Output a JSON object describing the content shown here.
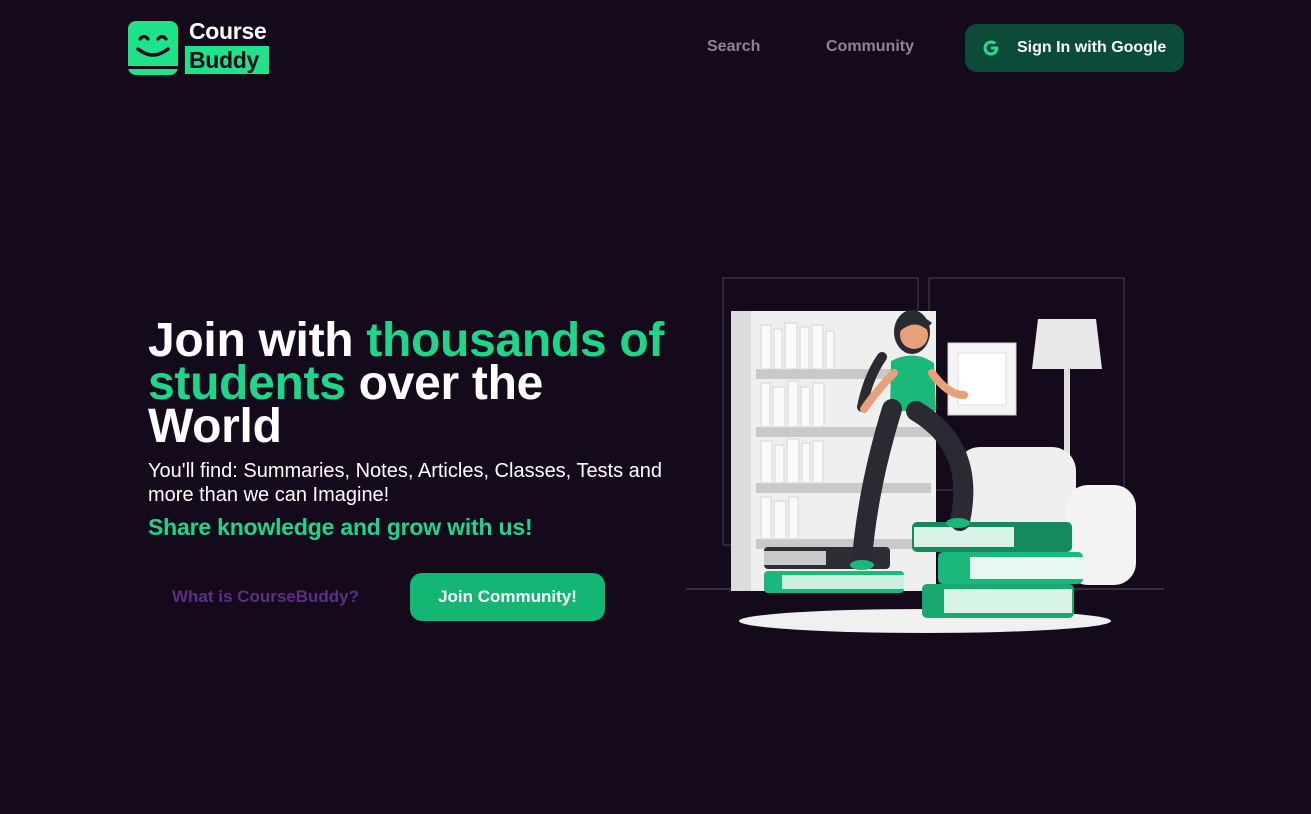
{
  "header": {
    "logo": {
      "line1": "Course",
      "line2": "Buddy"
    },
    "nav": {
      "search": "Search",
      "community": "Community"
    },
    "signin": {
      "label": "Sign In with Google",
      "icon": "google-icon"
    }
  },
  "hero": {
    "title": {
      "part1": "Join with ",
      "accent": "thousands of students",
      "part2": " over the World"
    },
    "subtitle": "You'll find: Summaries, Notes, Articles, Classes, Tests and more than we can Imagine!",
    "tagline": "Share knowledge and grow with us!",
    "buttons": {
      "what": "What is CourseBuddy?",
      "join": "Join Community!"
    }
  },
  "colors": {
    "background": "#140a1c",
    "accent": "#1dd68a",
    "logo_green": "#1fe38b",
    "google_button": "#0c4a3a",
    "join_button": "#13b672",
    "nav_text": "#8b8597",
    "secondary_link": "#5d2e85"
  },
  "illustration": {
    "icon": "student-climbing-books-illustration"
  }
}
